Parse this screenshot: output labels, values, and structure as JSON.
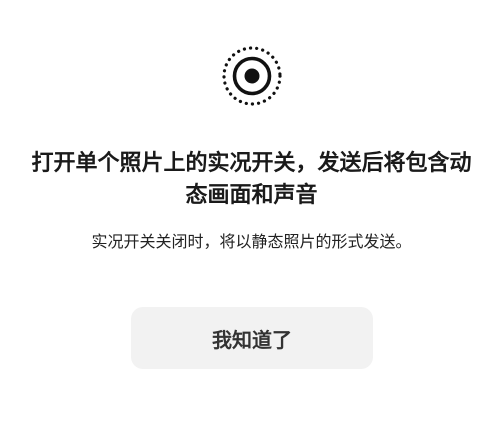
{
  "dialog": {
    "icon": "live-photo-icon",
    "title": "打开单个照片上的实况开关，发送后将包含动态画面和声音",
    "description": "实况开关关闭时，将以静态照片的形式发送。",
    "button_label": "我知道了"
  },
  "colors": {
    "background": "#ffffff",
    "title_text": "#1a1a1a",
    "description_text": "#222222",
    "button_background": "#f2f2f2",
    "button_text": "#333333",
    "icon": "#111111"
  }
}
